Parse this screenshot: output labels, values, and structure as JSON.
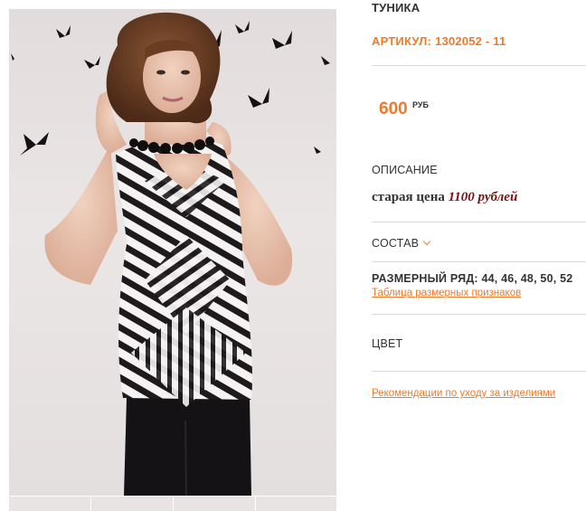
{
  "product": {
    "title": "ТУНИКА",
    "sku_label": "АРТИКУЛ:",
    "sku_value": "1302052 - 11",
    "price": "600",
    "currency": "РУБ",
    "photo_alt": "",
    "thumbnail_count": 4
  },
  "description": {
    "label": "ОПИСАНИЕ",
    "old_price_prefix": "старая цена",
    "old_price_value": "1100 рублей"
  },
  "composition": {
    "label": "СОСТАВ"
  },
  "sizes": {
    "label": "РАЗМЕРНЫЙ РЯД:",
    "values": "44, 46, 48, 50, 52",
    "size_chart_link": "Таблица размерных признаков"
  },
  "color": {
    "label": "ЦВЕТ"
  },
  "care_link": "Рекомендации по уходу за изделиями",
  "colors": {
    "accent": "#f07a2a",
    "text": "#333333",
    "old_price": "#7a1010",
    "divider": "#d9d9d9"
  }
}
